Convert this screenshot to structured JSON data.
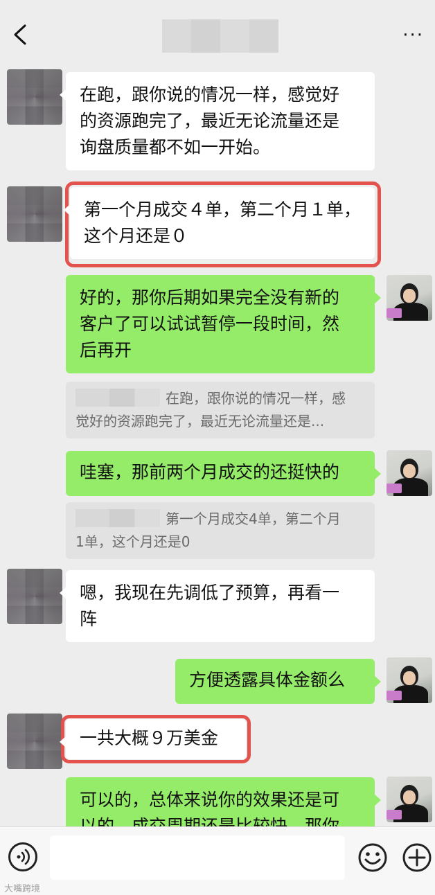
{
  "messages": [
    {
      "text_lines": [
        "在跑，跟你说的情况一样，感觉好",
        "的资源跑完了，最近无论流量还是",
        "询盘质量都不如一开始。"
      ]
    },
    {
      "text_lines": [
        "第一个月成交４单，第二个月１单，",
        "这个月还是０"
      ]
    },
    {
      "text_lines": [
        "好的，那你后期如果完全没有新的",
        "客户了可以试试暂停一段时间，然",
        "后再开"
      ]
    },
    {
      "quote_lines": [
        "在跑，跟你说的情况一样，感",
        "觉好的资源跑完了，最近无论流量还是..."
      ]
    },
    {
      "text_lines": [
        "哇塞，那前两个月成交的还挺快的"
      ]
    },
    {
      "quote_lines": [
        "第一个月成交4单，第二个月",
        "1单，这个月还是0"
      ]
    },
    {
      "text_lines": [
        "嗯，我现在先调低了预算，再看一",
        "阵"
      ]
    },
    {
      "text_lines": [
        "方便透露具体金额么"
      ]
    },
    {
      "text_lines": [
        "一共大概９万美金"
      ]
    },
    {
      "text_lines": [
        "可以的，总体来说你的效果还是可",
        "以的，成交周期还是比较快，那你"
      ]
    }
  ],
  "watermark": "大嘴跨境",
  "colors": {
    "background": "#ededed",
    "outgoing_bubble": "#95ec69",
    "incoming_bubble": "#ffffff",
    "highlight_border": "#e3524d",
    "quote_bg": "#e2e2e2"
  }
}
